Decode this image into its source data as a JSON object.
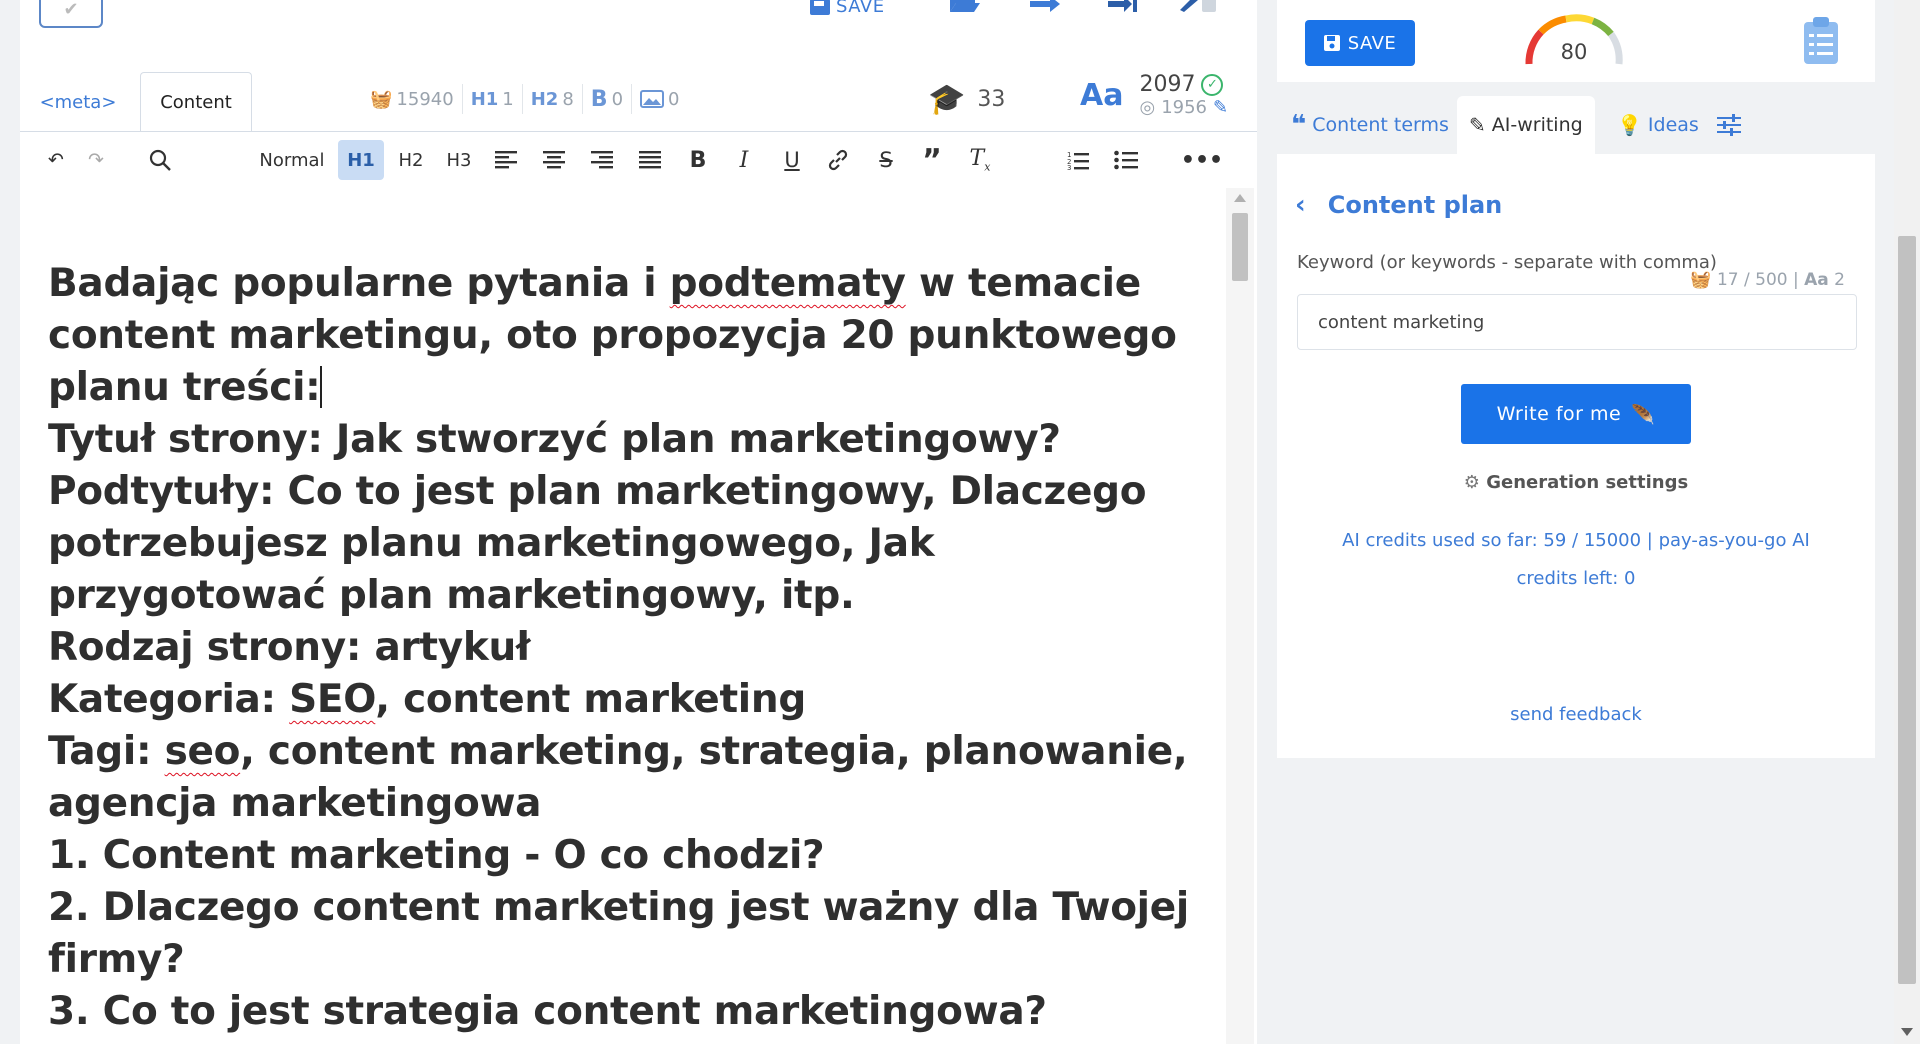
{
  "top_actions": {
    "save_label": "SAVE"
  },
  "tabs": {
    "meta": "<meta>",
    "content": "Content"
  },
  "stats": {
    "words_basket": "15940",
    "h1": "1",
    "h2": "8",
    "bold": "0",
    "images": "0",
    "h1_icon": "H1",
    "h2_icon": "H2",
    "bold_icon": "B"
  },
  "score_cap": "33",
  "aa": {
    "label": "Aa",
    "count_main": "2097",
    "count_sub": "1956"
  },
  "toolbar": {
    "normal": "Normal",
    "h1": "H1",
    "h2": "H2",
    "h3": "H3"
  },
  "editor": {
    "lines": [
      "Badając popularne pytania i ",
      "podtematy",
      " w temacie content marketingu, oto propozycja 20 punktowego planu treści:",
      "Tytuł strony: Jak stworzyć plan marketingowy?",
      "Podtytuły: Co to jest plan marketingowy, Dlaczego potrzebujesz planu marketingowego, Jak przygotować plan marketingowy, itp.",
      "Rodzaj strony: artykuł",
      "Kategoria: ",
      "SEO",
      ", content marketing",
      "Tagi: ",
      "seo",
      ", content marketing, strategia, planowanie, agencja marketingowa",
      "1. Content marketing - O co chodzi?",
      "2. Dlaczego content marketing jest ważny dla Twojej firmy?",
      "3. Co to jest strategia content marketingowa?"
    ]
  },
  "right": {
    "save_label": "SAVE",
    "score": "80",
    "tabs": {
      "content_terms": "Content terms",
      "ai_writing": "AI-writing",
      "ideas": "Ideas"
    },
    "content_plan_title": "Content plan",
    "keyword_label": "Keyword (or keywords - separate with comma)",
    "keyword_counter": "17 / 500 | ",
    "keyword_counter_aa": "Aa",
    "keyword_counter_num": " 2",
    "keyword_value": "content marketing",
    "write_button": "Write for me",
    "generation_settings": "Generation settings",
    "credits_line": "AI credits used so far: 59 / 15000 | pay-as-you-go AI credits left: 0",
    "send_feedback": "send feedback"
  },
  "colors": {
    "accent": "#1a73e8",
    "link": "#3d7bd6",
    "ok": "#3bb56c"
  }
}
